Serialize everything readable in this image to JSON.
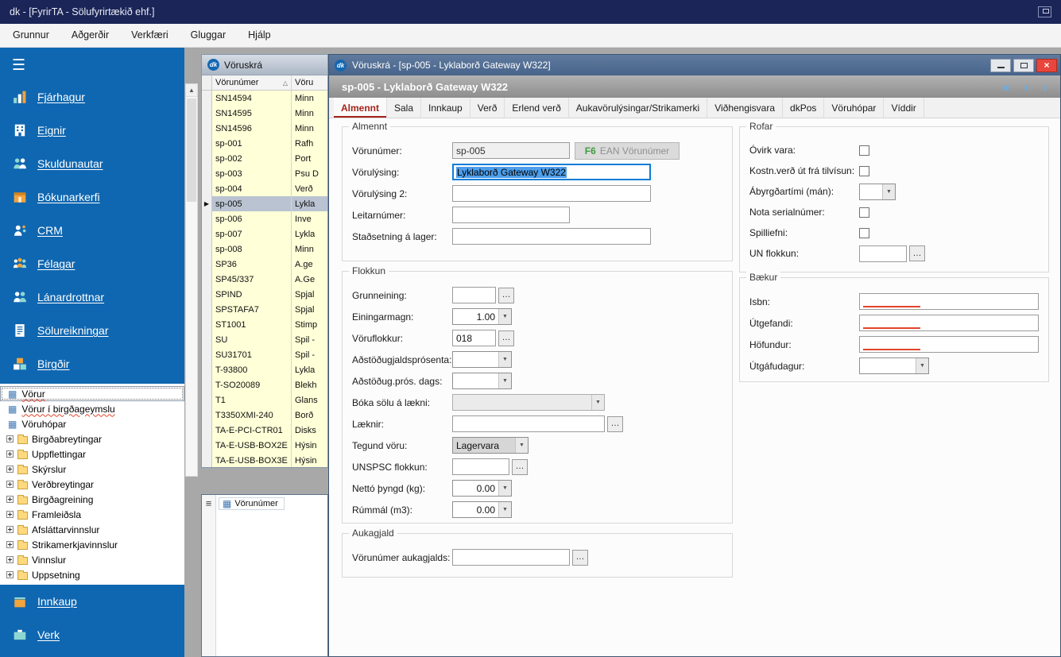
{
  "app": {
    "title": "dk - [FyrirTA - Sölufyrirtækið ehf.]"
  },
  "menubar": [
    "Grunnur",
    "Aðgerðir",
    "Verkfæri",
    "Gluggar",
    "Hjálp"
  ],
  "icons": {
    "hamburger": "☰",
    "menu_lines": "≡",
    "grid": "▦",
    "scroll_up": "▲",
    "first": "«",
    "prev": "‹",
    "next": "›",
    "close": "×",
    "dk_logo": "dk"
  },
  "colors": {
    "titlebar_navy": "#1B2557",
    "sidebar_blue": "#0F67B1",
    "row_yellow": "#FFFFD8",
    "selected_row": "#B9C3D1",
    "active_tab_red": "#A5231B",
    "close_red": "#E8463C",
    "selection_blue": "#4D9EEB",
    "nav_arrow_blue": "#5FB0F0",
    "spell_red": "#E2442B"
  },
  "sidebar": {
    "items": [
      {
        "label": "Fjárhagur"
      },
      {
        "label": "Eignir"
      },
      {
        "label": "Skuldunautar"
      },
      {
        "label": "Bókunarkerfi"
      },
      {
        "label": "CRM"
      },
      {
        "label": "Félagar"
      },
      {
        "label": "Lánardrottnar"
      },
      {
        "label": "Sölureikningar"
      },
      {
        "label": "Birgðir"
      }
    ],
    "views": [
      {
        "label": "Vörur"
      },
      {
        "label": "Vörur í birgðageymslu"
      },
      {
        "label": "Vöruhópar"
      }
    ],
    "folders": [
      "Birgðabreytingar",
      "Uppflettingar",
      "Skýrslur",
      "Verðbreytingar",
      "Birgðagreining",
      "Framleiðsla",
      "Afsláttarvinnslur",
      "Strikamerkjavinnslur",
      "Vinnslur",
      "Uppsetning"
    ],
    "bottom": [
      {
        "label": "Innkaup"
      },
      {
        "label": "Verk"
      }
    ]
  },
  "list_window": {
    "title": "Vöruskrá",
    "col1": "Vörunúmer",
    "col2": "Vöru",
    "filter_chip": "Vörunúmer",
    "rows": [
      {
        "n": "SN14594",
        "d": "Minn"
      },
      {
        "n": "SN14595",
        "d": "Minn"
      },
      {
        "n": "SN14596",
        "d": "Minn"
      },
      {
        "n": "sp-001",
        "d": "Rafh"
      },
      {
        "n": "sp-002",
        "d": "Port"
      },
      {
        "n": "sp-003",
        "d": "Psu D"
      },
      {
        "n": "sp-004",
        "d": "Verð"
      },
      {
        "n": "sp-005",
        "d": "Lykla",
        "_class": "sel"
      },
      {
        "n": "sp-006",
        "d": "Inve"
      },
      {
        "n": "sp-007",
        "d": "Lykla"
      },
      {
        "n": "sp-008",
        "d": "Minn"
      },
      {
        "n": "SP36",
        "d": "A.ge"
      },
      {
        "n": "SP45/337",
        "d": "A.Ge"
      },
      {
        "n": "SPIND",
        "d": "Spjal"
      },
      {
        "n": "SPSTAFA7",
        "d": "Spjal"
      },
      {
        "n": "ST1001",
        "d": "Stimp"
      },
      {
        "n": "SU",
        "d": "Spil -"
      },
      {
        "n": "SU31701",
        "d": "Spil -"
      },
      {
        "n": "T-93800",
        "d": "Lykla"
      },
      {
        "n": "T-SO20089",
        "d": "Blekh"
      },
      {
        "n": "T1",
        "d": "Glans"
      },
      {
        "n": "T3350XMI-240",
        "d": "Borð"
      },
      {
        "n": "TA-E-PCI-CTR01",
        "d": "Disks"
      },
      {
        "n": "TA-E-USB-BOX2E",
        "d": "Hýsin"
      },
      {
        "n": "TA-E-USB-BOX3E",
        "d": "Hýsin"
      }
    ]
  },
  "detail": {
    "title": "Vöruskrá - [sp-005 - Lyklaborð Gateway W322]",
    "record_header": "sp-005 - Lyklaborð Gateway W322",
    "tabs": [
      {
        "label": "Almennt",
        "_class": "active"
      },
      {
        "label": "Sala"
      },
      {
        "label": "Innkaup"
      },
      {
        "label": "Verð"
      },
      {
        "label": "Erlend verð"
      },
      {
        "label": "Aukavörulýsingar/Strikamerki"
      },
      {
        "label": "Viðhengisvara"
      },
      {
        "label": "dkPos"
      },
      {
        "label": "Vöruhópar"
      },
      {
        "label": "Víddir"
      }
    ],
    "almennt": {
      "legend": "Almennt",
      "vorunumer_label": "Vörunúmer:",
      "vorunumer_value": "sp-005",
      "ean_key": "F6",
      "ean_label": "EAN Vörunúmer",
      "vorulysing_label": "Vörulýsing:",
      "vorulysing_value": "Lyklaborð Gateway W322",
      "vorulysing2_label": "Vörulýsing 2:",
      "leitarnumer_label": "Leitarnúmer:",
      "stadsetning_label": "Staðsetning á lager:"
    },
    "flokkun": {
      "legend": "Flokkun",
      "grunneining_label": "Grunneining:",
      "einingarmagn_label": "Einingarmagn:",
      "einingarmagn_value": "1.00",
      "voruflokkur_label": "Vöruflokkur:",
      "voruflokkur_value": "018",
      "adstodugjaldsprosenta_label": "Aðstöðugjaldsprósenta:",
      "adstodug_dags_label": "Aðstöðug.prós. dags:",
      "boka_solu_label": "Bóka sölu á lækni:",
      "laeknir_label": "Læknir:",
      "tegund_label": "Tegund vöru:",
      "tegund_value": "Lagervara",
      "unspsc_label": "UNSPSC flokkun:",
      "netto_label": "Nettó þyngd (kg):",
      "netto_value": "0.00",
      "rummal_label": "Rúmmál (m3):",
      "rummal_value": "0.00"
    },
    "aukagjald": {
      "legend": "Aukagjald",
      "vorunumer_aukagjalds_label": "Vörunúmer aukagjalds:"
    },
    "rofar": {
      "legend": "Rofar",
      "ovirk_label": "Óvirk vara:",
      "kostnverd_label": "Kostn.verð út frá tilvísun:",
      "abyrgd_label": "Ábyrgðartími (mán):",
      "serial_label": "Nota serialnúmer:",
      "spilliefni_label": "Spilliefni:",
      "un_label": "UN flokkun:"
    },
    "baekur": {
      "legend": "Bækur",
      "isbn_label": "Isbn:",
      "utgefandi_label": "Útgefandi:",
      "hofundur_label": "Höfundur:",
      "utgafudagur_label": "Útgáfudagur:"
    }
  }
}
